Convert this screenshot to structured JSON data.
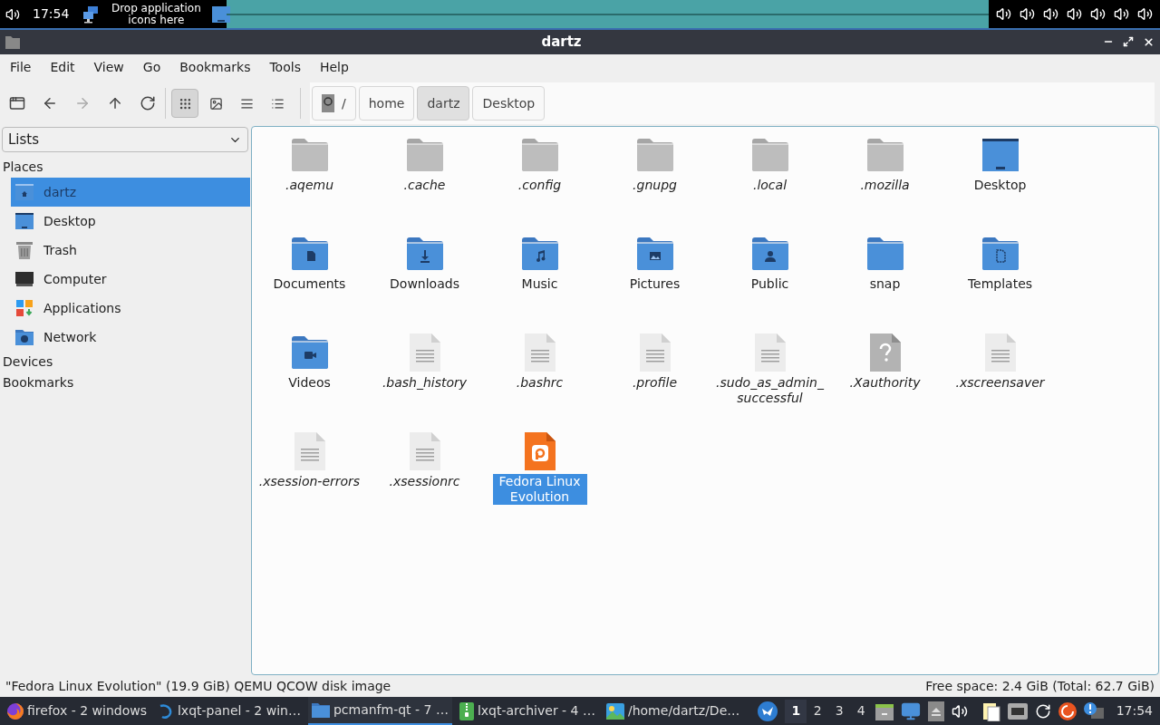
{
  "top_panel": {
    "clock": "17:54",
    "quicklaunch_hint": "Drop application icons here"
  },
  "window": {
    "title": "dartz"
  },
  "menu": [
    "File",
    "Edit",
    "View",
    "Go",
    "Bookmarks",
    "Tools",
    "Help"
  ],
  "view_modes": [
    {
      "kind": "icons",
      "selected": true
    },
    {
      "kind": "thumbnails",
      "selected": false
    },
    {
      "kind": "compact",
      "selected": false
    },
    {
      "kind": "detailed",
      "selected": false
    }
  ],
  "path": [
    {
      "label": "/",
      "kind": "root",
      "selected": false
    },
    {
      "label": "home",
      "kind": "dir",
      "selected": false
    },
    {
      "label": "dartz",
      "kind": "dir",
      "selected": true
    },
    {
      "label": "Desktop",
      "kind": "dir",
      "selected": false
    }
  ],
  "sidebar": {
    "mode": "Lists",
    "sections": [
      {
        "title": "Places",
        "items": [
          {
            "label": "dartz",
            "kind": "home",
            "selected": true
          },
          {
            "label": "Desktop",
            "kind": "desktop",
            "selected": false
          },
          {
            "label": "Trash",
            "kind": "trash",
            "selected": false
          },
          {
            "label": "Computer",
            "kind": "computer",
            "selected": false
          },
          {
            "label": "Applications",
            "kind": "apps",
            "selected": false
          },
          {
            "label": "Network",
            "kind": "network",
            "selected": false
          }
        ]
      },
      {
        "title": "Devices"
      },
      {
        "title": "Bookmarks"
      }
    ]
  },
  "files": [
    {
      "name": ".aqemu",
      "kind": "folder",
      "hidden": true,
      "selected": false
    },
    {
      "name": ".cache",
      "kind": "folder",
      "hidden": true,
      "selected": false
    },
    {
      "name": ".config",
      "kind": "folder",
      "hidden": true,
      "selected": false
    },
    {
      "name": ".gnupg",
      "kind": "folder",
      "hidden": true,
      "selected": false
    },
    {
      "name": ".local",
      "kind": "folder",
      "hidden": true,
      "selected": false
    },
    {
      "name": ".mozilla",
      "kind": "folder",
      "hidden": true,
      "selected": false
    },
    {
      "name": "Desktop",
      "kind": "desktop",
      "hidden": false,
      "selected": false
    },
    {
      "name": "Documents",
      "kind": "documents",
      "hidden": false,
      "selected": false
    },
    {
      "name": "Downloads",
      "kind": "downloads",
      "hidden": false,
      "selected": false
    },
    {
      "name": "Music",
      "kind": "music",
      "hidden": false,
      "selected": false
    },
    {
      "name": "Pictures",
      "kind": "pictures",
      "hidden": false,
      "selected": false
    },
    {
      "name": "Public",
      "kind": "public",
      "hidden": false,
      "selected": false
    },
    {
      "name": "snap",
      "kind": "folder",
      "hidden": false,
      "selected": false
    },
    {
      "name": "Templates",
      "kind": "templates",
      "hidden": false,
      "selected": false
    },
    {
      "name": "Videos",
      "kind": "videos",
      "hidden": false,
      "selected": false
    },
    {
      "name": ".bash_history",
      "kind": "text",
      "hidden": true,
      "selected": false
    },
    {
      "name": ".bashrc",
      "kind": "text",
      "hidden": true,
      "selected": false
    },
    {
      "name": ".profile",
      "kind": "text",
      "hidden": true,
      "selected": false
    },
    {
      "name": ".sudo_as_admin_ successful",
      "kind": "text",
      "hidden": true,
      "selected": false
    },
    {
      "name": ".Xauthority",
      "kind": "unknown",
      "hidden": true,
      "selected": false
    },
    {
      "name": ".xscreensaver",
      "kind": "text",
      "hidden": true,
      "selected": false
    },
    {
      "name": ".xsession-errors",
      "kind": "text",
      "hidden": true,
      "selected": false
    },
    {
      "name": ".xsessionrc",
      "kind": "text",
      "hidden": true,
      "selected": false
    },
    {
      "name": "Fedora Linux Evolution",
      "kind": "disk",
      "hidden": false,
      "selected": true
    }
  ],
  "status_bar": {
    "selection": "\"Fedora Linux Evolution\" (19.9 GiB) QEMU QCOW disk image",
    "free_space": "Free space: 2.4 GiB (Total: 62.7 GiB)"
  },
  "taskbar": {
    "tasks": [
      {
        "label": "firefox - 2 windows",
        "kind": "browser",
        "selected": false
      },
      {
        "label": "lxqt-panel - 2 win…",
        "kind": "panel",
        "selected": false
      },
      {
        "label": "pcmanfm-qt - 7 …",
        "kind": "files",
        "selected": true
      },
      {
        "label": "lxqt-archiver - 4 …",
        "kind": "archiver",
        "selected": false
      },
      {
        "label": "/home/dartz/De…",
        "kind": "image",
        "selected": false
      }
    ],
    "workspaces": [
      {
        "label": "1",
        "selected": true
      },
      {
        "label": "2",
        "selected": false
      },
      {
        "label": "3",
        "selected": false
      },
      {
        "label": "4",
        "selected": false
      }
    ],
    "clock": "17:54"
  }
}
